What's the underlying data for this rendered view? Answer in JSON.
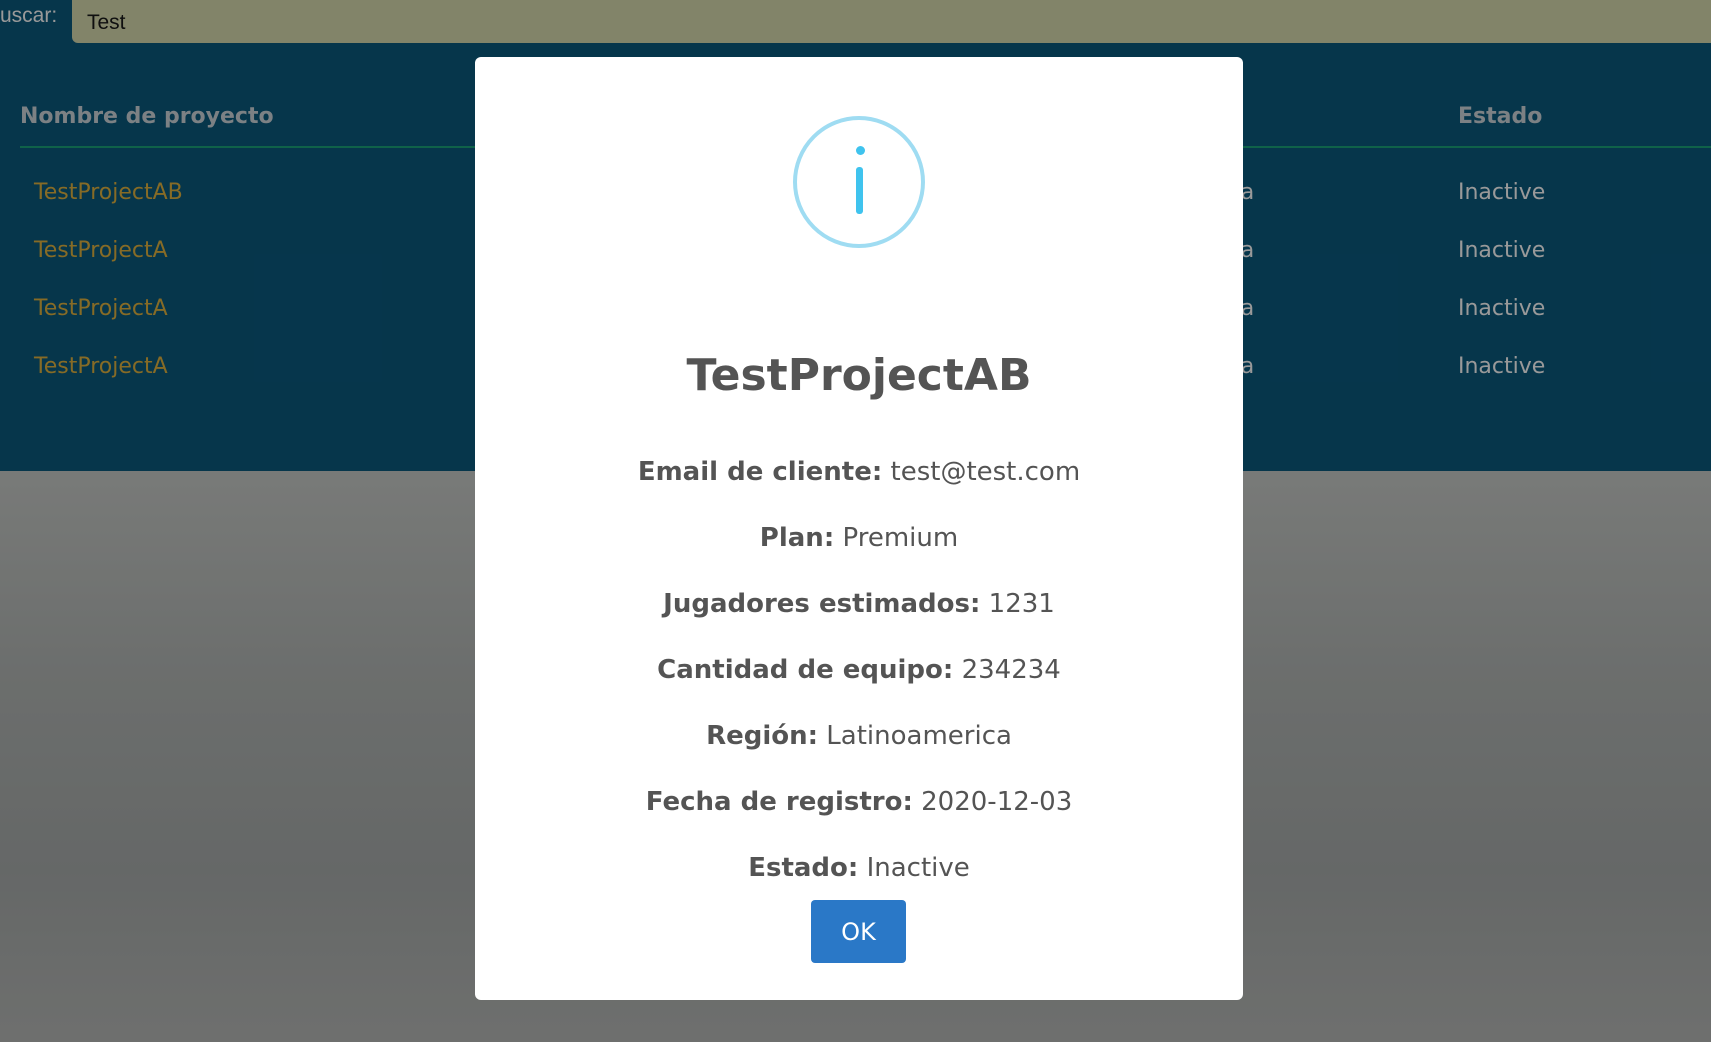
{
  "search": {
    "label": "uscar:",
    "value": "Test"
  },
  "table": {
    "headers": {
      "name": "Nombre de proyecto",
      "state": "Estado"
    },
    "rows": [
      {
        "name": "TestProjectAB",
        "region": "erica",
        "state": "Inactive"
      },
      {
        "name": "TestProjectA",
        "region": "erica",
        "state": "Inactive"
      },
      {
        "name": "TestProjectA",
        "region": "erica",
        "state": "Inactive"
      },
      {
        "name": "TestProjectA",
        "region": "erica",
        "state": "Inactive"
      }
    ]
  },
  "modal": {
    "icon": "info-icon",
    "title": "TestProjectAB",
    "fields": [
      {
        "key": "Email de cliente:",
        "value": "test@test.com"
      },
      {
        "key": "Plan:",
        "value": "Premium"
      },
      {
        "key": "Jugadores estimados:",
        "value": "1231"
      },
      {
        "key": "Cantidad de equipo:",
        "value": "234234"
      },
      {
        "key": "Región:",
        "value": "Latinoamerica"
      },
      {
        "key": "Fecha de registro:",
        "value": "2020-12-03"
      },
      {
        "key": "Estado:",
        "value": "Inactive"
      }
    ],
    "ok_label": "OK"
  },
  "colors": {
    "panel": "#0a5a7e",
    "project_link": "#e0b340",
    "info_accent": "#3fc3ee",
    "ok_button": "#2a78c7"
  }
}
